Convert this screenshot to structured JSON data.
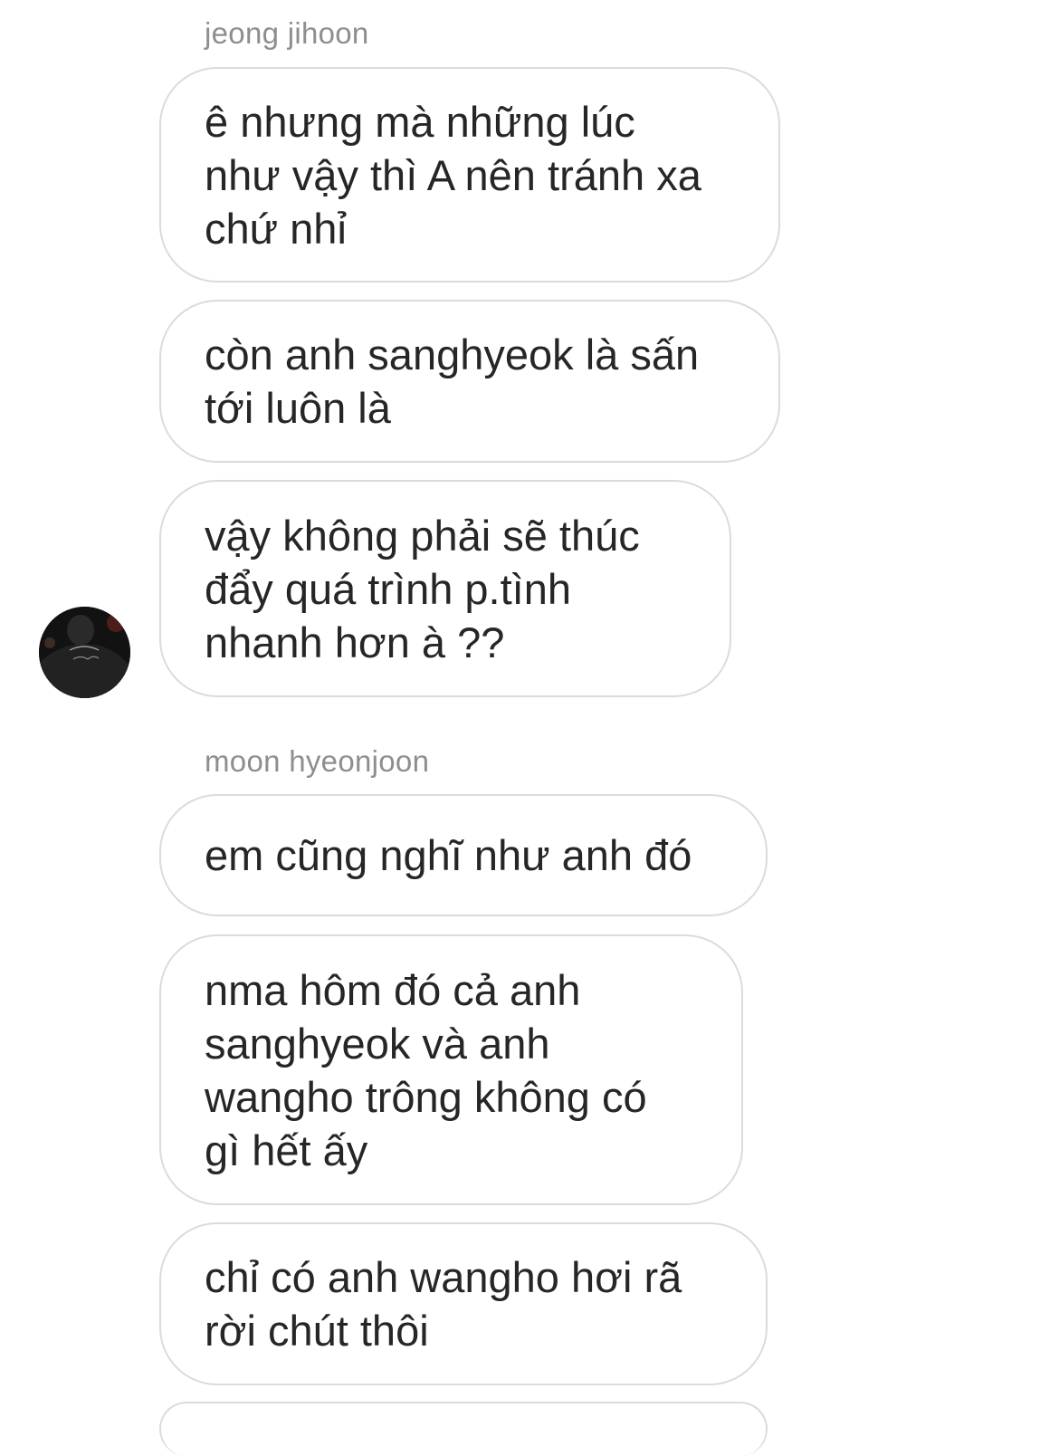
{
  "conversation": {
    "groups": [
      {
        "sender": "jeong jihoon",
        "messages": [
          "ê nhưng mà những lúc\nnhư vậy thì A nên tránh xa\nchứ nhỉ",
          "còn anh sanghyeok là sấn\ntới luôn là",
          "vậy không phải sẽ thúc\nđẩy quá trình p.tình\nnhanh hơn à ??"
        ]
      },
      {
        "sender": "moon hyeonjoon",
        "messages": [
          "em cũng nghĩ như anh đó",
          "nma hôm đó cả anh\nsanghyeok và anh\nwangho trông không có\ngì hết ấy",
          "chỉ có anh wangho hơi rã\nrời chút thôi"
        ]
      }
    ],
    "avatar_icon": "user-photo-avatar"
  },
  "colors": {
    "bubble_border": "#dbdbdb",
    "sender_text": "#8e8e8e",
    "message_text": "#262626"
  }
}
